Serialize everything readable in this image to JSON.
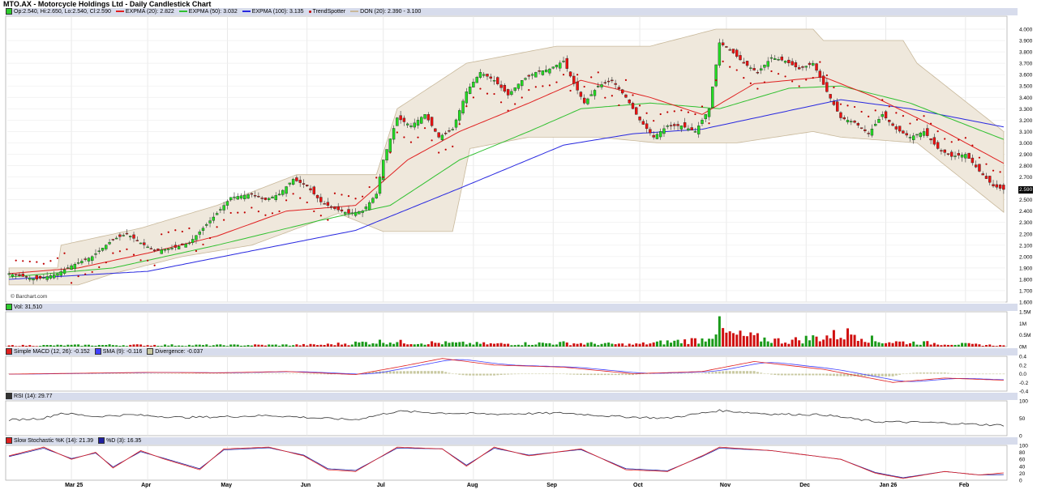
{
  "title": "MTO.AX - Motorcycle Holdings Ltd - Daily Candlestick Chart",
  "legends": {
    "price": [
      {
        "label": "Op:2.540, Hi:2.650, Lo:2.540, Cl:2.590",
        "kind": "swatch",
        "color": "#2ecc2e"
      },
      {
        "label": "EXPMA (20): 2.822",
        "kind": "line",
        "color": "#e02020"
      },
      {
        "label": "EXPMA (50): 3.032",
        "kind": "line",
        "color": "#30c030"
      },
      {
        "label": "EXPMA (100): 3.135",
        "kind": "line",
        "color": "#2828e0"
      },
      {
        "label": "TrendSpotter",
        "kind": "dot",
        "color": "#c00000"
      },
      {
        "label": "DON (20): 2.390 - 3.100",
        "kind": "line",
        "color": "#c8b89a"
      }
    ],
    "volume": [
      {
        "label": "Vol: 31,510",
        "kind": "swatch",
        "color": "#2ecc2e"
      }
    ],
    "macd": [
      {
        "label": "Simple MACD (12, 26): -0.152",
        "kind": "swatch",
        "color": "#e02020"
      },
      {
        "label": "SMA (9): -0.116",
        "kind": "swatch",
        "color": "#4040ff"
      },
      {
        "label": "Divergence: -0.037",
        "kind": "swatch",
        "color": "#c8c8a0"
      }
    ],
    "rsi": [
      {
        "label": "RSI (14): 29.77",
        "kind": "swatch",
        "color": "#333333"
      }
    ],
    "stoch": [
      {
        "label": "Slow Stochastic %K (14): 21.39",
        "kind": "swatch",
        "color": "#e02020"
      },
      {
        "label": "%D (3): 16.35",
        "kind": "swatch",
        "color": "#2020a0"
      }
    ]
  },
  "attribution": "© Barchart.com",
  "last_price_label": "2.590",
  "chart_data": {
    "type": "candlestick",
    "title": "MTO.AX - Motorcycle Holdings Ltd - Daily Candlestick Chart",
    "x_labels": [
      "Mar 25",
      "Apr",
      "May",
      "Jun",
      "Jul",
      "Aug",
      "Sep",
      "Oct",
      "Nov",
      "Dec",
      "Jan 26",
      "Feb"
    ],
    "price_axis": {
      "ylim": [
        1.6,
        4.0
      ],
      "ticks": [
        "1.600",
        "1.700",
        "1.800",
        "1.900",
        "2.000",
        "2.100",
        "2.200",
        "2.300",
        "2.400",
        "2.500",
        "2.600",
        "2.700",
        "2.800",
        "2.900",
        "3.000",
        "3.100",
        "3.200",
        "3.300",
        "3.400",
        "3.500",
        "3.600",
        "3.700",
        "3.800",
        "3.900",
        "4.000"
      ]
    },
    "volume_axis": {
      "ticks": [
        "0M",
        "0.5M",
        "1M",
        "1.5M"
      ],
      "ylim": [
        0,
        1500000
      ]
    },
    "macd_axis": {
      "ticks": [
        "0.4",
        "0.2",
        "0.0",
        "-0.2",
        "-0.4"
      ],
      "ylim": [
        -0.4,
        0.4
      ]
    },
    "rsi_axis": {
      "ticks": [
        "100",
        "50",
        "0"
      ],
      "ylim": [
        0,
        100
      ]
    },
    "stoch_axis": {
      "ticks": [
        "100",
        "80",
        "60",
        "40",
        "20",
        "0"
      ],
      "ylim": [
        0,
        100
      ]
    },
    "close_keypoints": [
      [
        0,
        1.85
      ],
      [
        8,
        1.8
      ],
      [
        14,
        1.85
      ],
      [
        18,
        1.92
      ],
      [
        24,
        2.0
      ],
      [
        30,
        2.15
      ],
      [
        34,
        2.2
      ],
      [
        38,
        2.12
      ],
      [
        42,
        2.05
      ],
      [
        48,
        2.08
      ],
      [
        52,
        2.12
      ],
      [
        56,
        2.25
      ],
      [
        60,
        2.38
      ],
      [
        64,
        2.52
      ],
      [
        70,
        2.55
      ],
      [
        74,
        2.5
      ],
      [
        78,
        2.55
      ],
      [
        82,
        2.68
      ],
      [
        86,
        2.62
      ],
      [
        90,
        2.48
      ],
      [
        94,
        2.42
      ],
      [
        98,
        2.38
      ],
      [
        102,
        2.4
      ],
      [
        106,
        2.55
      ],
      [
        108,
        2.85
      ],
      [
        112,
        3.22
      ],
      [
        116,
        3.15
      ],
      [
        120,
        3.25
      ],
      [
        124,
        3.05
      ],
      [
        128,
        3.12
      ],
      [
        132,
        3.45
      ],
      [
        136,
        3.62
      ],
      [
        140,
        3.55
      ],
      [
        144,
        3.42
      ],
      [
        148,
        3.55
      ],
      [
        152,
        3.62
      ],
      [
        156,
        3.65
      ],
      [
        160,
        3.72
      ],
      [
        163,
        3.52
      ],
      [
        166,
        3.35
      ],
      [
        170,
        3.5
      ],
      [
        174,
        3.55
      ],
      [
        178,
        3.4
      ],
      [
        182,
        3.2
      ],
      [
        186,
        3.05
      ],
      [
        190,
        3.15
      ],
      [
        194,
        3.15
      ],
      [
        198,
        3.1
      ],
      [
        202,
        3.3
      ],
      [
        205,
        3.88
      ],
      [
        208,
        3.82
      ],
      [
        212,
        3.7
      ],
      [
        216,
        3.62
      ],
      [
        220,
        3.75
      ],
      [
        224,
        3.72
      ],
      [
        228,
        3.65
      ],
      [
        232,
        3.7
      ],
      [
        236,
        3.45
      ],
      [
        240,
        3.22
      ],
      [
        244,
        3.18
      ],
      [
        248,
        3.08
      ],
      [
        252,
        3.25
      ],
      [
        256,
        3.12
      ],
      [
        260,
        3.05
      ],
      [
        264,
        3.1
      ],
      [
        268,
        2.95
      ],
      [
        272,
        2.88
      ],
      [
        276,
        2.9
      ],
      [
        280,
        2.75
      ],
      [
        284,
        2.62
      ],
      [
        287,
        2.59
      ]
    ],
    "ema20_keypoints": [
      [
        0,
        1.85
      ],
      [
        20,
        1.9
      ],
      [
        40,
        2.03
      ],
      [
        60,
        2.18
      ],
      [
        80,
        2.4
      ],
      [
        100,
        2.45
      ],
      [
        115,
        2.85
      ],
      [
        130,
        3.1
      ],
      [
        150,
        3.35
      ],
      [
        165,
        3.55
      ],
      [
        185,
        3.4
      ],
      [
        200,
        3.25
      ],
      [
        215,
        3.52
      ],
      [
        235,
        3.58
      ],
      [
        250,
        3.4
      ],
      [
        270,
        3.1
      ],
      [
        287,
        2.82
      ]
    ],
    "ema50_keypoints": [
      [
        0,
        1.82
      ],
      [
        30,
        1.9
      ],
      [
        60,
        2.1
      ],
      [
        90,
        2.32
      ],
      [
        110,
        2.45
      ],
      [
        130,
        2.85
      ],
      [
        150,
        3.1
      ],
      [
        165,
        3.3
      ],
      [
        185,
        3.35
      ],
      [
        205,
        3.3
      ],
      [
        225,
        3.48
      ],
      [
        240,
        3.5
      ],
      [
        260,
        3.35
      ],
      [
        287,
        3.03
      ]
    ],
    "ema100_keypoints": [
      [
        0,
        1.8
      ],
      [
        40,
        1.87
      ],
      [
        70,
        2.05
      ],
      [
        100,
        2.23
      ],
      [
        130,
        2.6
      ],
      [
        160,
        2.98
      ],
      [
        180,
        3.08
      ],
      [
        200,
        3.12
      ],
      [
        220,
        3.25
      ],
      [
        240,
        3.38
      ],
      [
        260,
        3.3
      ],
      [
        287,
        3.14
      ]
    ],
    "donchian_upper_keypoints": [
      [
        0,
        1.9
      ],
      [
        14,
        1.9
      ],
      [
        15,
        2.1
      ],
      [
        38,
        2.25
      ],
      [
        60,
        2.45
      ],
      [
        83,
        2.72
      ],
      [
        106,
        2.72
      ],
      [
        112,
        3.3
      ],
      [
        132,
        3.7
      ],
      [
        158,
        3.85
      ],
      [
        185,
        3.85
      ],
      [
        204,
        4.0
      ],
      [
        232,
        4.0
      ],
      [
        235,
        3.9
      ],
      [
        258,
        3.9
      ],
      [
        262,
        3.7
      ],
      [
        287,
        3.1
      ]
    ],
    "donchian_lower_keypoints": [
      [
        0,
        1.75
      ],
      [
        20,
        1.75
      ],
      [
        30,
        1.85
      ],
      [
        50,
        2.0
      ],
      [
        70,
        2.1
      ],
      [
        95,
        2.38
      ],
      [
        108,
        2.22
      ],
      [
        128,
        2.22
      ],
      [
        133,
        2.95
      ],
      [
        150,
        3.05
      ],
      [
        170,
        3.05
      ],
      [
        187,
        3.0
      ],
      [
        210,
        3.0
      ],
      [
        232,
        3.1
      ],
      [
        240,
        3.05
      ],
      [
        262,
        3.0
      ],
      [
        287,
        2.39
      ]
    ],
    "volume_keypoints": [
      [
        0,
        60000
      ],
      [
        30,
        90000
      ],
      [
        60,
        80000
      ],
      [
        90,
        100000
      ],
      [
        109,
        300000
      ],
      [
        112,
        250000
      ],
      [
        140,
        150000
      ],
      [
        160,
        200000
      ],
      [
        180,
        120000
      ],
      [
        200,
        400000
      ],
      [
        205,
        1100000
      ],
      [
        207,
        700000
      ],
      [
        224,
        300000
      ],
      [
        245,
        800000
      ],
      [
        250,
        300000
      ],
      [
        287,
        60000
      ]
    ],
    "macd_keypoints": [
      [
        0,
        -0.01
      ],
      [
        20,
        0.01
      ],
      [
        40,
        0.03
      ],
      [
        60,
        0.02
      ],
      [
        80,
        0.05
      ],
      [
        100,
        -0.02
      ],
      [
        112,
        0.15
      ],
      [
        125,
        0.35
      ],
      [
        140,
        0.2
      ],
      [
        160,
        0.15
      ],
      [
        180,
        0.0
      ],
      [
        200,
        0.05
      ],
      [
        215,
        0.28
      ],
      [
        235,
        0.1
      ],
      [
        255,
        -0.2
      ],
      [
        270,
        -0.1
      ],
      [
        287,
        -0.15
      ]
    ],
    "rsi_keypoints": [
      [
        0,
        45
      ],
      [
        10,
        50
      ],
      [
        15,
        65
      ],
      [
        25,
        55
      ],
      [
        35,
        60
      ],
      [
        50,
        52
      ],
      [
        65,
        55
      ],
      [
        75,
        58
      ],
      [
        90,
        50
      ],
      [
        100,
        46
      ],
      [
        112,
        70
      ],
      [
        125,
        65
      ],
      [
        140,
        62
      ],
      [
        160,
        65
      ],
      [
        175,
        55
      ],
      [
        190,
        50
      ],
      [
        205,
        72
      ],
      [
        220,
        62
      ],
      [
        235,
        60
      ],
      [
        250,
        40
      ],
      [
        265,
        38
      ],
      [
        280,
        32
      ],
      [
        287,
        30
      ]
    ],
    "stoch_k_keypoints": [
      [
        0,
        70
      ],
      [
        10,
        95
      ],
      [
        18,
        60
      ],
      [
        25,
        80
      ],
      [
        30,
        35
      ],
      [
        38,
        85
      ],
      [
        45,
        60
      ],
      [
        55,
        30
      ],
      [
        62,
        90
      ],
      [
        75,
        95
      ],
      [
        85,
        70
      ],
      [
        92,
        30
      ],
      [
        100,
        25
      ],
      [
        112,
        95
      ],
      [
        125,
        90
      ],
      [
        132,
        40
      ],
      [
        140,
        95
      ],
      [
        150,
        70
      ],
      [
        165,
        90
      ],
      [
        178,
        30
      ],
      [
        190,
        25
      ],
      [
        200,
        70
      ],
      [
        205,
        95
      ],
      [
        220,
        85
      ],
      [
        240,
        60
      ],
      [
        250,
        20
      ],
      [
        258,
        5
      ],
      [
        270,
        25
      ],
      [
        280,
        15
      ],
      [
        287,
        21
      ]
    ],
    "stoch_d_keypoints": [
      [
        0,
        68
      ],
      [
        10,
        92
      ],
      [
        18,
        62
      ],
      [
        25,
        78
      ],
      [
        30,
        38
      ],
      [
        38,
        82
      ],
      [
        45,
        62
      ],
      [
        55,
        33
      ],
      [
        62,
        87
      ],
      [
        75,
        93
      ],
      [
        85,
        72
      ],
      [
        92,
        33
      ],
      [
        100,
        28
      ],
      [
        112,
        92
      ],
      [
        125,
        90
      ],
      [
        132,
        43
      ],
      [
        140,
        92
      ],
      [
        150,
        72
      ],
      [
        165,
        88
      ],
      [
        178,
        33
      ],
      [
        190,
        27
      ],
      [
        200,
        68
      ],
      [
        205,
        92
      ],
      [
        220,
        85
      ],
      [
        240,
        60
      ],
      [
        250,
        22
      ],
      [
        258,
        7
      ],
      [
        270,
        25
      ],
      [
        280,
        15
      ],
      [
        287,
        16
      ]
    ]
  }
}
